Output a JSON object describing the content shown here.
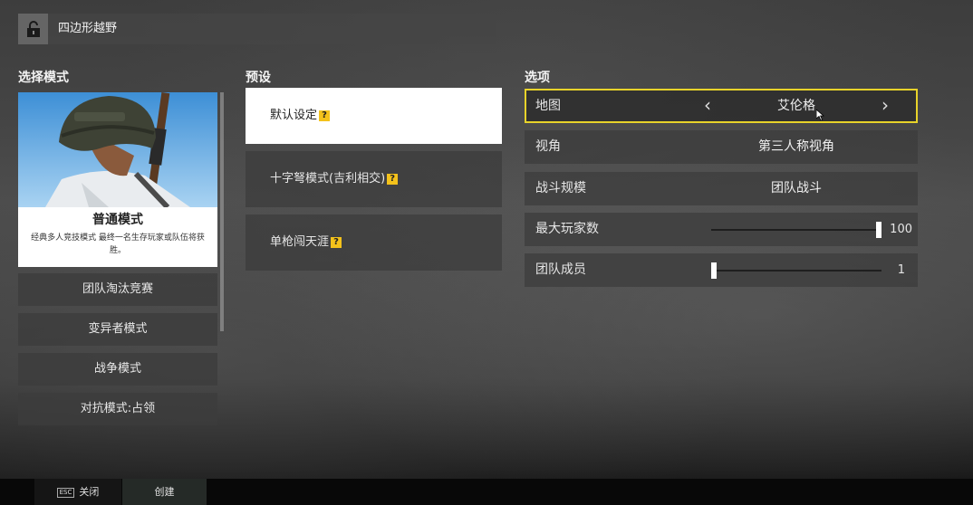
{
  "header": {
    "room_name": "四边形越野",
    "lock_icon": "unlock-icon"
  },
  "sections": {
    "mode": "选择模式",
    "preset": "预设",
    "options": "选项"
  },
  "mode_card": {
    "name": "普通模式",
    "description": "经典多人竞技模式 最终一名生存玩家或队伍将获胜。"
  },
  "modes": [
    "团队淘汰竞赛",
    "变异者模式",
    "战争模式",
    "对抗模式:占领"
  ],
  "presets": [
    {
      "label": "默认设定",
      "help": "?",
      "active": true
    },
    {
      "label": "十字弩模式(吉利相交)",
      "help": "?",
      "active": false
    },
    {
      "label": "单枪闯天涯",
      "help": "?",
      "active": false
    }
  ],
  "options": {
    "map": {
      "label": "地图",
      "value": "艾伦格"
    },
    "perspective": {
      "label": "视角",
      "value": "第三人称视角"
    },
    "team_size_mode": {
      "label": "战斗规模",
      "value": "团队战斗"
    },
    "max_players": {
      "label": "最大玩家数",
      "value": "100",
      "fill": 1.0
    },
    "team_members": {
      "label": "团队成员",
      "value": "1",
      "fill": 0.0
    }
  },
  "footer": {
    "esc_key": "ESC",
    "close_label": "关闭",
    "create_label": "创建"
  },
  "colors": {
    "accent": "#e8d32a",
    "help_badge": "#f4c21b"
  }
}
